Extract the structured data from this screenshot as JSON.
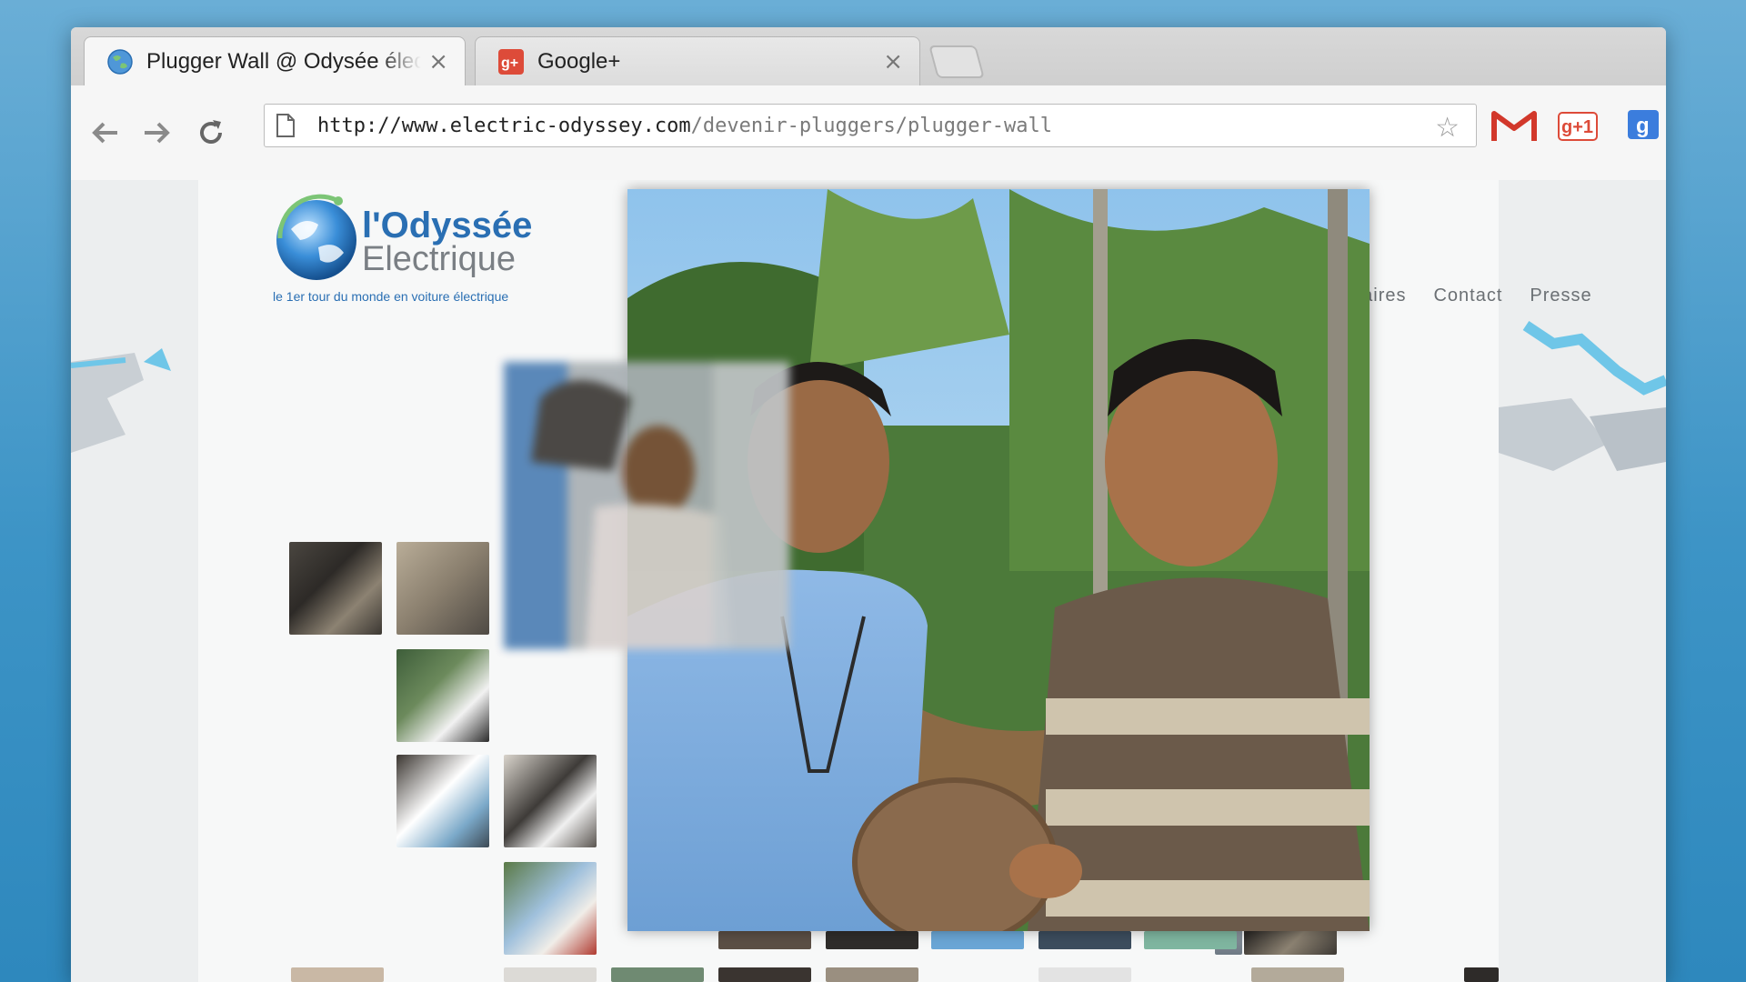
{
  "browser": {
    "tabs": [
      {
        "title": "Plugger Wall @ Odysée électrique",
        "active": true,
        "favicon": "globe-icon"
      },
      {
        "title": "Google+",
        "active": false,
        "favicon": "google-plus-icon"
      }
    ],
    "url_host": "http://www.electric-odyssey.com",
    "url_path": "/devenir-pluggers/plugger-wall",
    "extensions": [
      "gmail-icon",
      "google-plus-one-icon",
      "google-search-icon",
      "menu-icon"
    ],
    "close_glyph": "×"
  },
  "site": {
    "logo_line1": "l'Odyssée",
    "logo_line2": "Electrique",
    "tagline": "le 1er tour du monde en voiture électrique",
    "nav": [
      "naires",
      "Contact",
      "Presse"
    ]
  },
  "colors": {
    "brand_blue": "#2a6fb3",
    "desktop_blue": "#3d94c6",
    "gmail_red": "#d2382b",
    "gplus_red": "#dd4b39",
    "google_blue": "#3b7ddd"
  }
}
